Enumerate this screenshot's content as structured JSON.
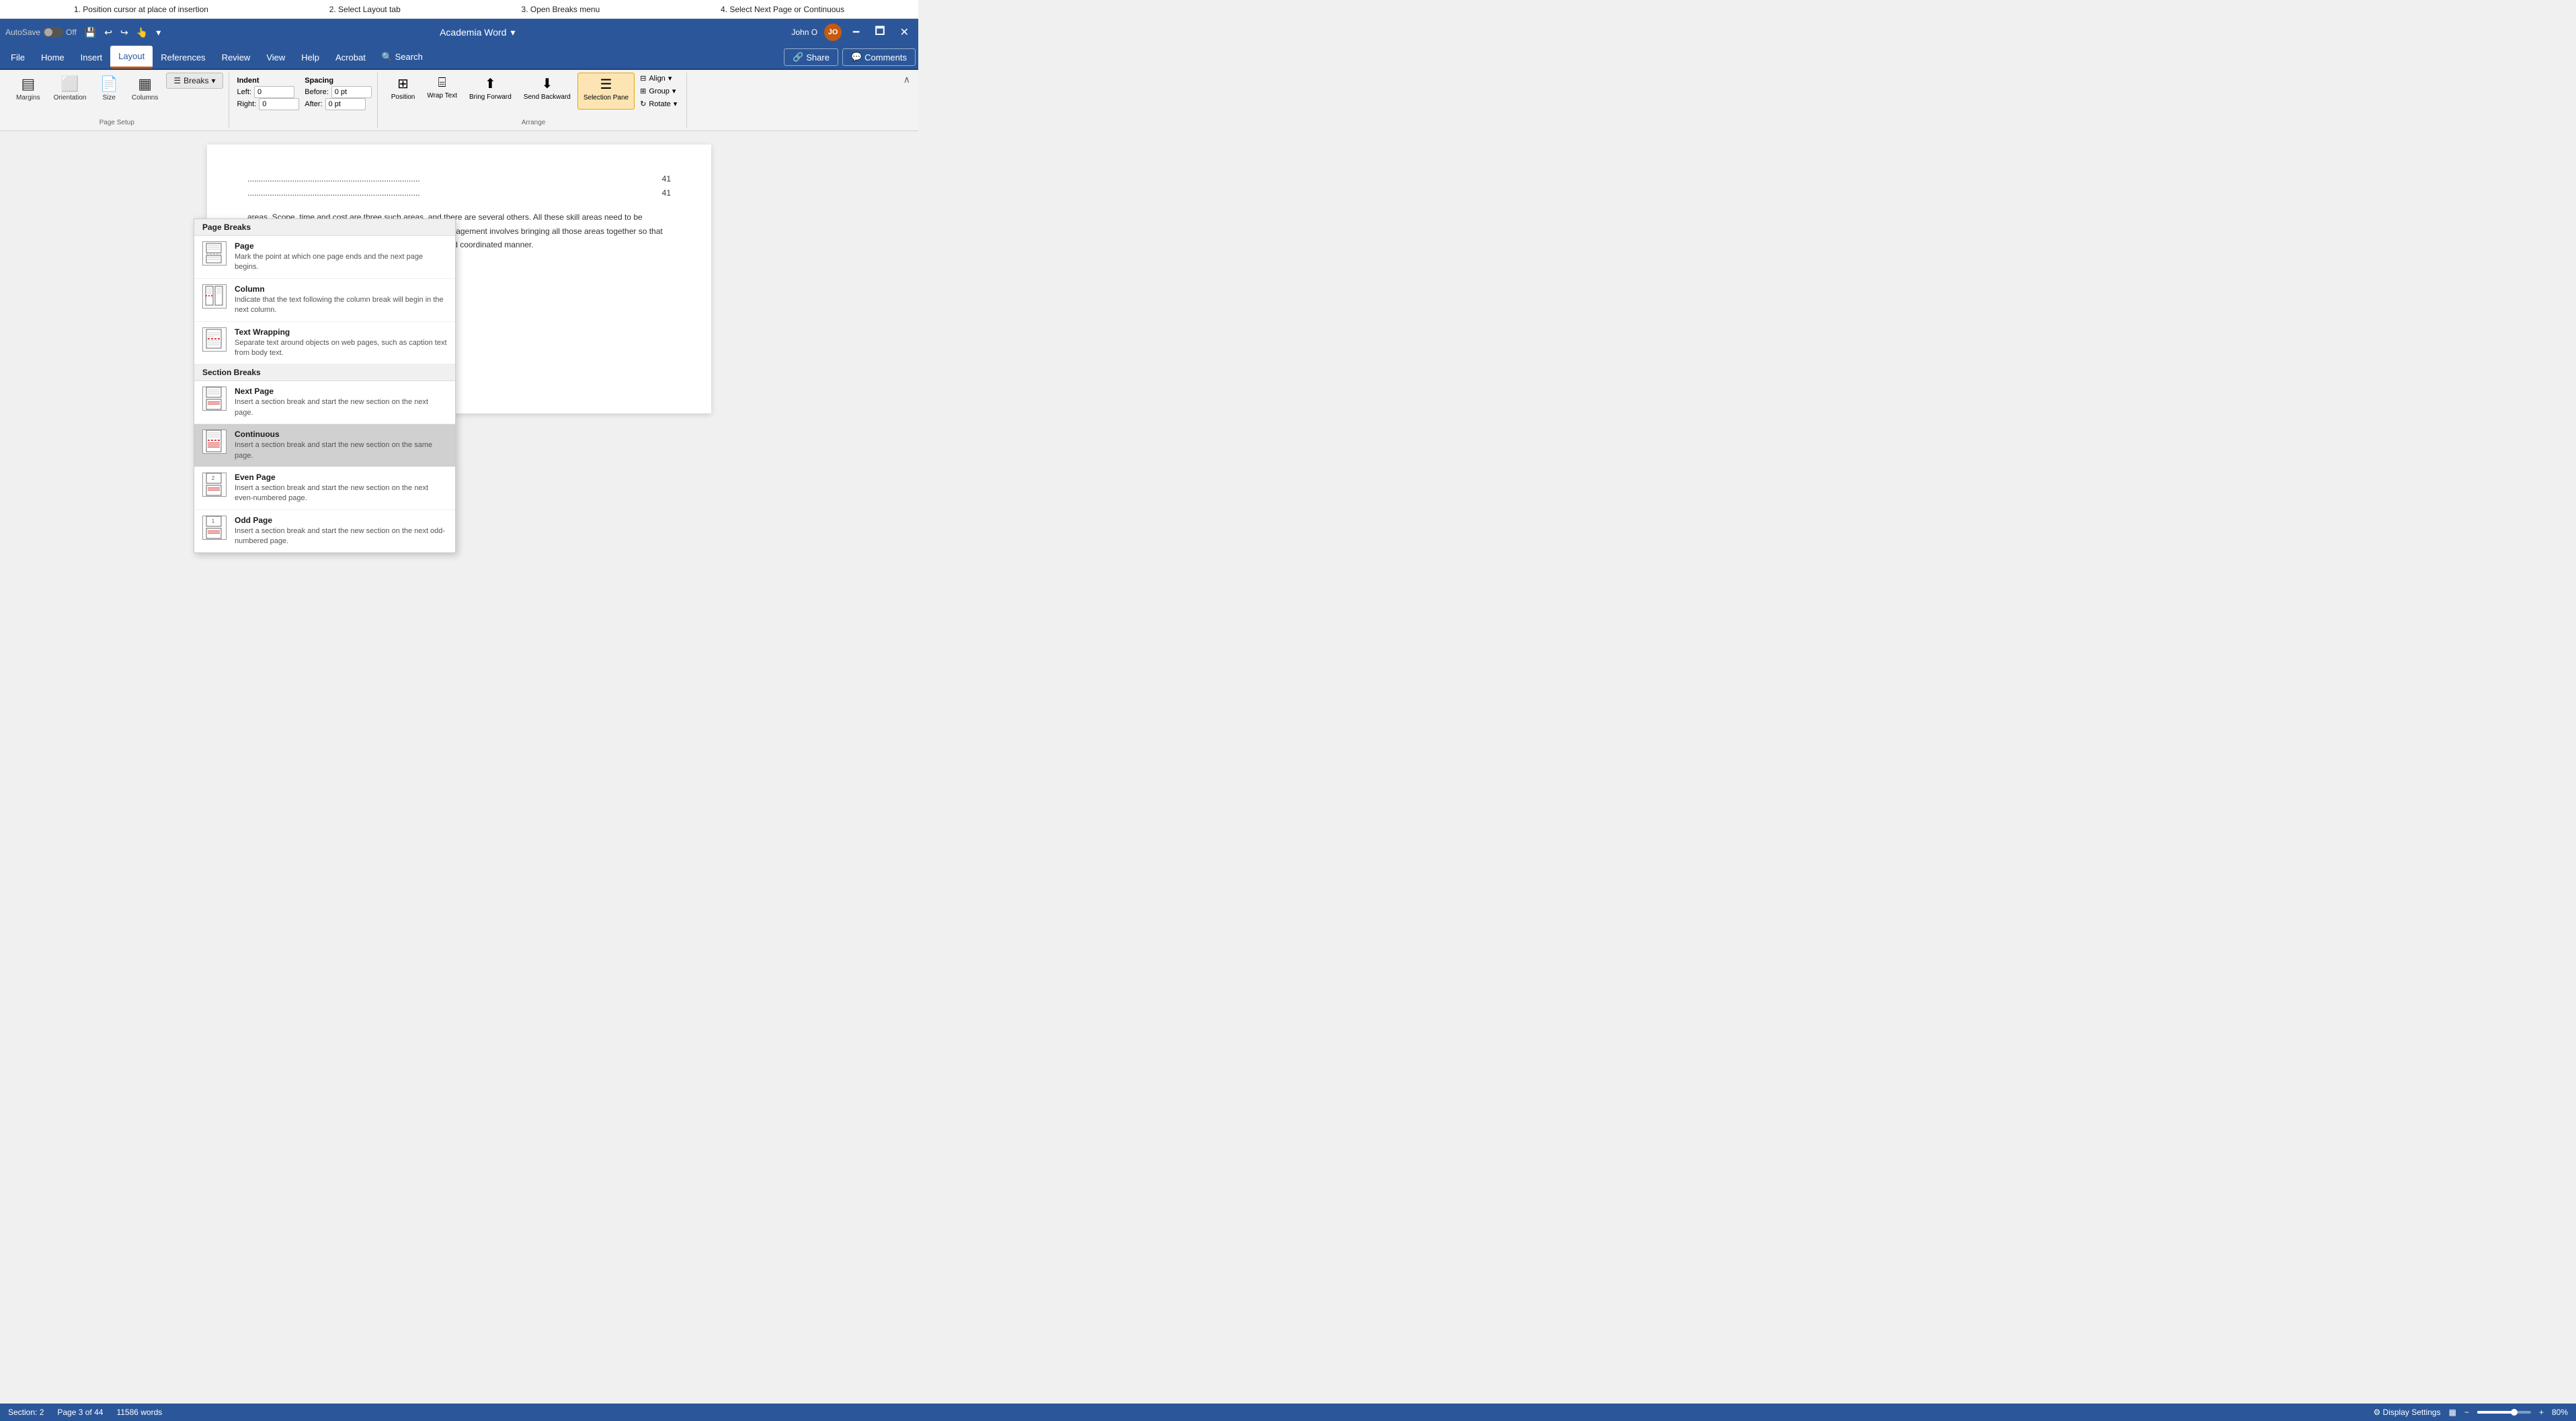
{
  "instructions": {
    "step1": "1. Position cursor at place of insertion",
    "step2": "2. Select Layout tab",
    "step3": "3. Open Breaks menu",
    "step4": "4. Select Next Page or Continuous"
  },
  "titlebar": {
    "autosave_label": "AutoSave",
    "autosave_state": "Off",
    "app_title": "Academia Word",
    "user_name": "John O",
    "user_initials": "JO",
    "minimize": "🗕",
    "maximize": "🗖",
    "close": "✕"
  },
  "menubar": {
    "items": [
      {
        "id": "file",
        "label": "File"
      },
      {
        "id": "home",
        "label": "Home"
      },
      {
        "id": "insert",
        "label": "Insert"
      },
      {
        "id": "layout",
        "label": "Layout"
      },
      {
        "id": "references",
        "label": "References"
      },
      {
        "id": "review",
        "label": "Review"
      },
      {
        "id": "view",
        "label": "View"
      },
      {
        "id": "help",
        "label": "Help"
      },
      {
        "id": "acrobat",
        "label": "Acrobat"
      },
      {
        "id": "search",
        "label": "🔍 Search"
      }
    ],
    "share_label": "Share",
    "comments_label": "Comments"
  },
  "ribbon": {
    "breaks_label": "Breaks",
    "indent_label": "Indent",
    "indent_left_label": "Left:",
    "indent_left_value": "0",
    "indent_right_label": "Right:",
    "indent_right_value": "0",
    "spacing_label": "Spacing",
    "spacing_before_label": "Before:",
    "spacing_before_value": "0 pt",
    "spacing_after_label": "After:",
    "spacing_after_value": "0 pt",
    "pagesetup_label": "Page Setup",
    "arrange_label": "Arrange",
    "position_label": "Position",
    "wrap_text_label": "Wrap Text",
    "bring_forward_label": "Bring Forward",
    "send_backward_label": "Send Backward",
    "selection_pane_label": "Selection Pane",
    "align_label": "Align",
    "group_label": "Group",
    "rotate_label": "Rotate",
    "margins_label": "Margins",
    "orientation_label": "Orientation",
    "size_label": "Size",
    "columns_label": "Columns",
    "collapse_btn": "∧"
  },
  "breaks_menu": {
    "page_breaks_header": "Page Breaks",
    "items": [
      {
        "id": "page",
        "title": "Page",
        "description": "Mark the point at which one page ends and the next page begins.",
        "highlighted": false
      },
      {
        "id": "column",
        "title": "Column",
        "description": "Indicate that the text following the column break will begin in the next column.",
        "highlighted": false
      },
      {
        "id": "text_wrapping",
        "title": "Text Wrapping",
        "description": "Separate text around objects on web pages, such as caption text from body text.",
        "highlighted": false
      }
    ],
    "section_breaks_header": "Section Breaks",
    "section_items": [
      {
        "id": "next_page",
        "title": "Next Page",
        "description": "Insert a section break and start the new section on the next page.",
        "highlighted": false
      },
      {
        "id": "continuous",
        "title": "Continuous",
        "description": "Insert a section break and start the new section on the same page.",
        "highlighted": true
      },
      {
        "id": "even_page",
        "title": "Even Page",
        "description": "Insert a section break and start the new section on the next even-numbered page.",
        "highlighted": false
      },
      {
        "id": "odd_page",
        "title": "Odd Page",
        "description": "Insert a section break and start the new section on the next odd-numbered page.",
        "highlighted": false
      }
    ]
  },
  "document": {
    "toc": [
      {
        "text": "...........................................................................",
        "page": "41"
      },
      {
        "text": "...........................................................................",
        "page": "41"
      }
    ],
    "body_text": "areas. Scope, time and cost are three such areas, and there are several others. All these skill areas need to be managed in an integrated manner. Project Integration management involves bringing all those areas together so that the project management process happens in a smooth and coordinated manner."
  },
  "statusbar": {
    "section": "Section: 2",
    "page": "Page 3 of 44",
    "words": "11586 words",
    "display_settings": "Display Settings",
    "zoom_level": "80%",
    "layout_icon": "▦"
  }
}
